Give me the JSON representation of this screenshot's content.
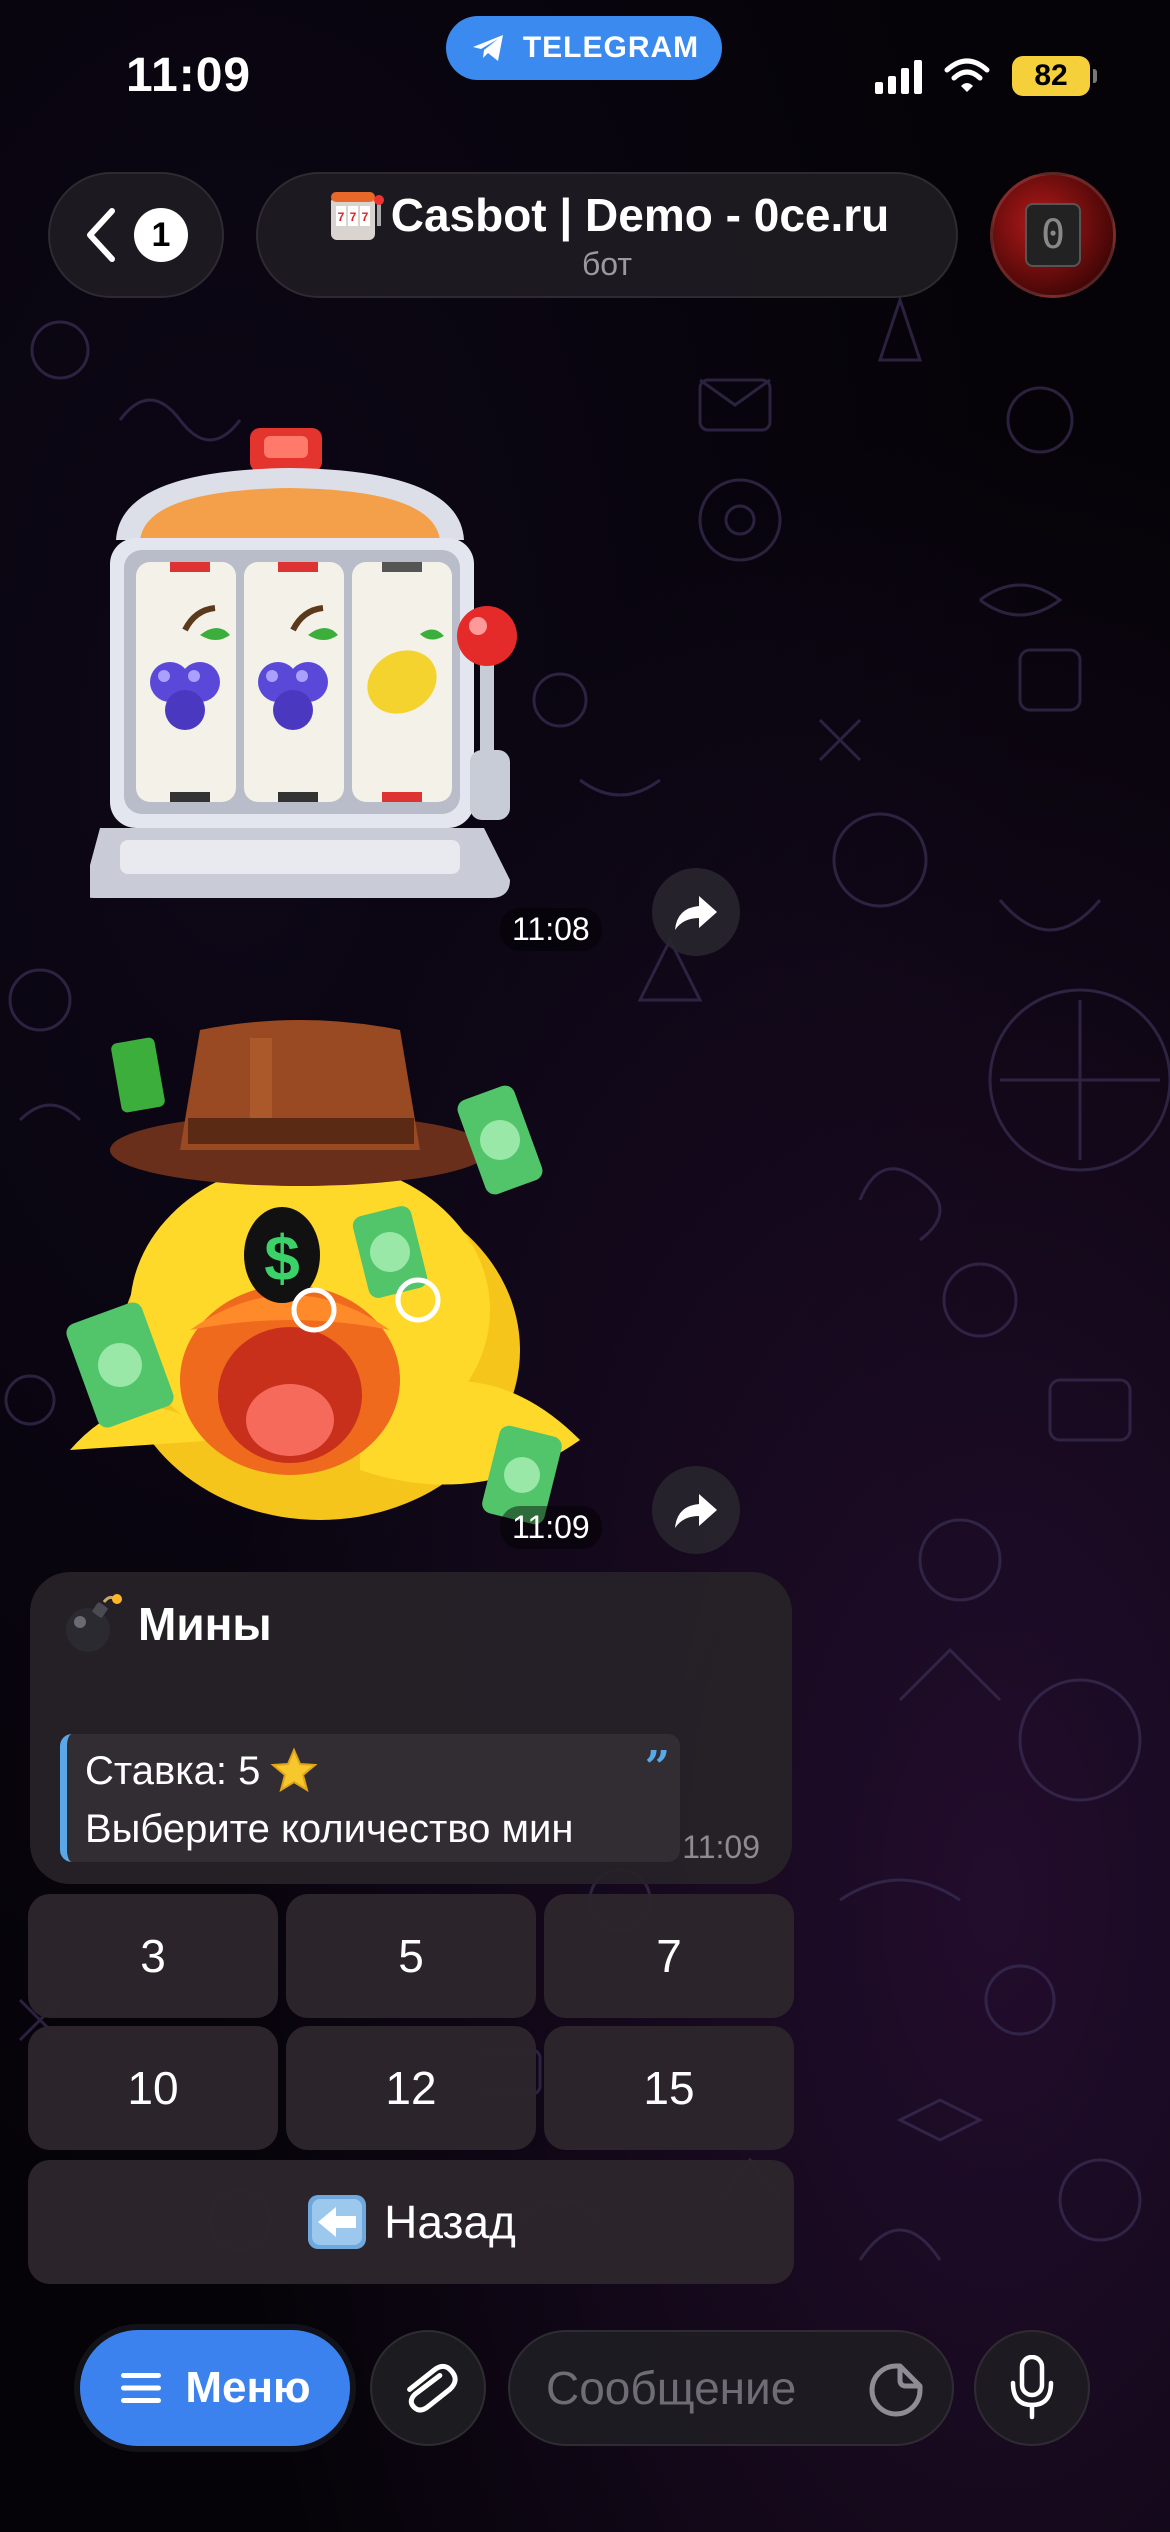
{
  "status_bar": {
    "time": "11:09",
    "app_pill": "TELEGRAM",
    "battery": "82"
  },
  "header": {
    "back_badge": "1",
    "title": "Casbot | Demo - 0ce.ru",
    "subtitle": "бот",
    "avatar_label": "0"
  },
  "messages": {
    "sticker_slot": {
      "time": "11:08",
      "icon": "slot-machine-sticker"
    },
    "sticker_duck": {
      "time": "11:09",
      "icon": "money-duck-sticker"
    },
    "mines": {
      "title": "Мины",
      "stake_label": "Ставка: 5",
      "prompt": "Выберите количество мин",
      "time": "11:09"
    }
  },
  "keyboard": {
    "row1": [
      "3",
      "5",
      "7"
    ],
    "row2": [
      "10",
      "12",
      "15"
    ],
    "back": "Назад"
  },
  "input_bar": {
    "menu_label": "Меню",
    "placeholder": "Сообщение"
  },
  "colors": {
    "accent": "#3b82ee",
    "quote_bar": "#5aa8e8",
    "battery": "#f5d03b"
  }
}
